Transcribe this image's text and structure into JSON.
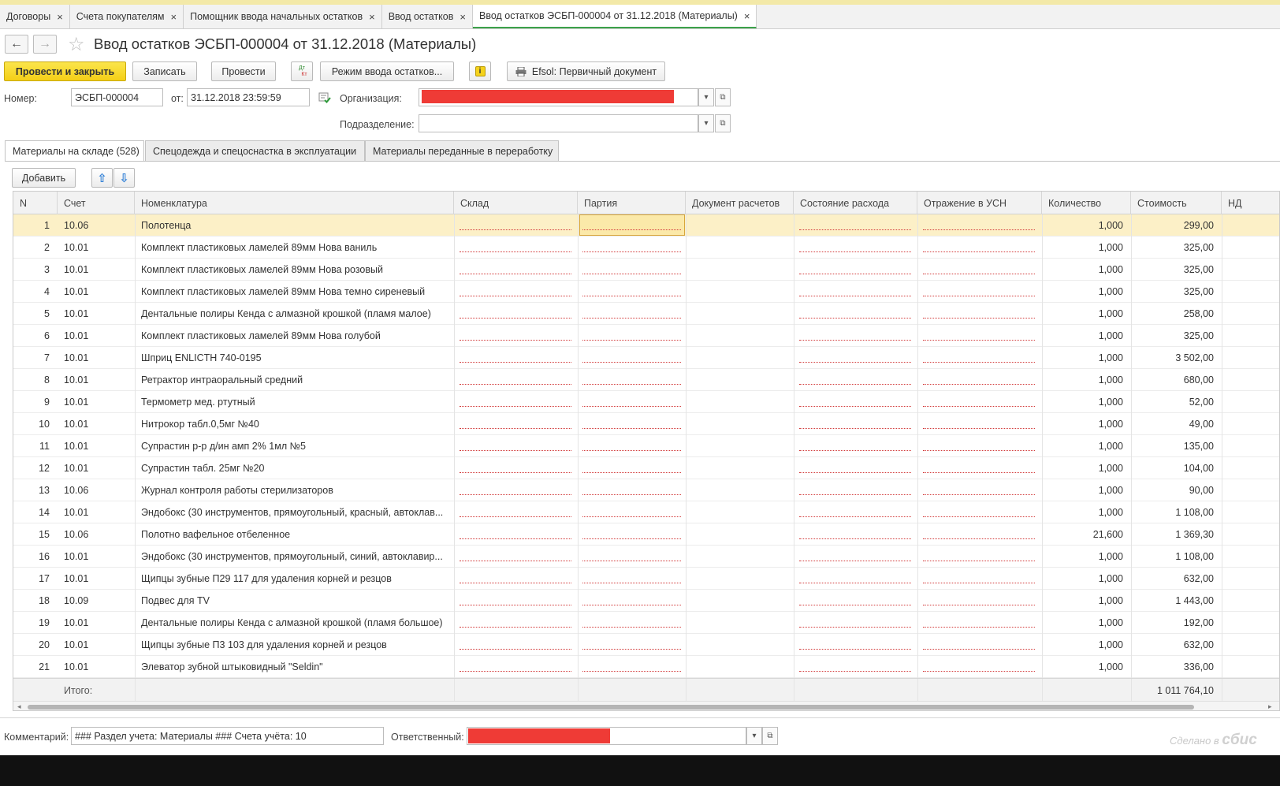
{
  "tabs": [
    {
      "label": "Договоры"
    },
    {
      "label": "Счета покупателям"
    },
    {
      "label": "Помощник ввода начальных остатков"
    },
    {
      "label": "Ввод остатков"
    },
    {
      "label": "Ввод остатков ЭСБП-000004 от 31.12.2018 (Материалы)"
    }
  ],
  "close_glyph": "×",
  "nav": {
    "back": "←",
    "forward": "→",
    "star": "☆"
  },
  "document_title": "Ввод остатков ЭСБП-000004 от 31.12.2018 (Материалы)",
  "toolbar": {
    "post_close": "Провести и закрыть",
    "save": "Записать",
    "post": "Провести",
    "dtkt_top": "Дт",
    "dtkt_bottom": "Кт",
    "mode": "Режим ввода остатков...",
    "info": "i",
    "efsol": "Efsol: Первичный документ"
  },
  "header": {
    "number_label": "Номер:",
    "number_value": "ЭСБП-000004",
    "date_label": "от:",
    "date_value": "31.12.2018 23:59:59",
    "org_label": "Организация:",
    "org_value": "",
    "subdivision_label": "Подразделение:",
    "subdivision_value": ""
  },
  "section_tabs": [
    {
      "label": "Материалы на складе (528)"
    },
    {
      "label": "Спецодежда и спецоснастка в эксплуатации"
    },
    {
      "label": "Материалы переданные в переработку"
    }
  ],
  "table_toolbar": {
    "add": "Добавить",
    "up": "⇧",
    "down": "⇩"
  },
  "columns": [
    "N",
    "Счет",
    "Номенклатура",
    "Склад",
    "Партия",
    "Документ расчетов",
    "Состояние расхода",
    "Отражение в УСН",
    "Количество",
    "Стоимость",
    "НД"
  ],
  "rows": [
    {
      "n": "1",
      "account": "10.06",
      "name": "Полотенца",
      "qty": "1,000",
      "cost": "299,00"
    },
    {
      "n": "2",
      "account": "10.01",
      "name": "Комплект пластиковых ламелей 89мм Нова ваниль",
      "qty": "1,000",
      "cost": "325,00"
    },
    {
      "n": "3",
      "account": "10.01",
      "name": "Комплект пластиковых ламелей 89мм Нова розовый",
      "qty": "1,000",
      "cost": "325,00"
    },
    {
      "n": "4",
      "account": "10.01",
      "name": "Комплект пластиковых ламелей 89мм Нова темно сиреневый",
      "qty": "1,000",
      "cost": "325,00"
    },
    {
      "n": "5",
      "account": "10.01",
      "name": "Дентальные полиры Кенда с алмазной крошкой (пламя малое)",
      "qty": "1,000",
      "cost": "258,00"
    },
    {
      "n": "6",
      "account": "10.01",
      "name": "Комплект пластиковых ламелей 89мм Нова голубой",
      "qty": "1,000",
      "cost": "325,00"
    },
    {
      "n": "7",
      "account": "10.01",
      "name": "Шприц ENLICTH 740-0195",
      "qty": "1,000",
      "cost": "3 502,00"
    },
    {
      "n": "8",
      "account": "10.01",
      "name": "Ретрактор интраоральный  средний",
      "qty": "1,000",
      "cost": "680,00"
    },
    {
      "n": "9",
      "account": "10.01",
      "name": "Термометр мед. ртутный",
      "qty": "1,000",
      "cost": "52,00"
    },
    {
      "n": "10",
      "account": "10.01",
      "name": "Нитрокор табл.0,5мг №40",
      "qty": "1,000",
      "cost": "49,00"
    },
    {
      "n": "11",
      "account": "10.01",
      "name": "Супрастин р-р д/ин амп 2% 1мл №5",
      "qty": "1,000",
      "cost": "135,00"
    },
    {
      "n": "12",
      "account": "10.01",
      "name": "Супрастин табл. 25мг №20",
      "qty": "1,000",
      "cost": "104,00"
    },
    {
      "n": "13",
      "account": "10.06",
      "name": "Журнал контроля работы стерилизаторов",
      "qty": "1,000",
      "cost": "90,00"
    },
    {
      "n": "14",
      "account": "10.01",
      "name": "Эндобокс (30 инструментов, прямоугольный, красный, автоклав...",
      "qty": "1,000",
      "cost": "1 108,00"
    },
    {
      "n": "15",
      "account": "10.06",
      "name": "Полотно вафельное отбеленное",
      "qty": "21,600",
      "cost": "1 369,30"
    },
    {
      "n": "16",
      "account": "10.01",
      "name": "Эндобокс (30 инструментов, прямоугольный, синий, автоклавир...",
      "qty": "1,000",
      "cost": "1 108,00"
    },
    {
      "n": "17",
      "account": "10.01",
      "name": "Щипцы зубные П29 117 для удаления корней и резцов",
      "qty": "1,000",
      "cost": "632,00"
    },
    {
      "n": "18",
      "account": "10.09",
      "name": "Подвес для TV",
      "qty": "1,000",
      "cost": "1 443,00"
    },
    {
      "n": "19",
      "account": "10.01",
      "name": "Дентальные полиры Кенда с алмазной крошкой (пламя большое)",
      "qty": "1,000",
      "cost": "192,00"
    },
    {
      "n": "20",
      "account": "10.01",
      "name": "Щипцы зубные П3 103 для удаления корней и резцов",
      "qty": "1,000",
      "cost": "632,00"
    },
    {
      "n": "21",
      "account": "10.01",
      "name": "Элеватор зубной штыковидный \"Seldin\"",
      "qty": "1,000",
      "cost": "336,00"
    }
  ],
  "footer": {
    "total_label": "Итого:",
    "total_cost": "1 011 764,10"
  },
  "bottom": {
    "comment_label": "Комментарий:",
    "comment_value": "### Раздел учета: Материалы ### Счета учёта: 10",
    "responsible_label": "Ответственный:",
    "responsible_value": ""
  },
  "watermark": {
    "prefix": "Сделано в",
    "brand": "сбис"
  },
  "colors": {
    "primary_button": "#f4cf17",
    "selected_row": "#fcf0c7",
    "active_tab_underline": "#3ca24a",
    "redaction": "#ef3b36"
  }
}
